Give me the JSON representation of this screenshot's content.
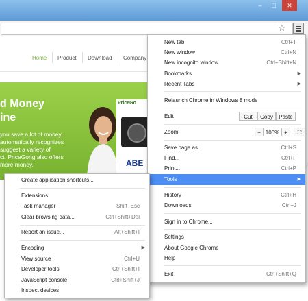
{
  "site": {
    "nav": [
      "Home",
      "Product",
      "Download",
      "Company"
    ],
    "hero_title_1": "d Money",
    "hero_title_2": "ine",
    "hero_lines": [
      "you save a lot of money.",
      "automatically recognizes",
      "suggest a variety of",
      "ct. PriceGong also offers",
      "more money."
    ],
    "pricegong_label": "PriceGo",
    "abe_label": "ABE"
  },
  "chrome_menu": {
    "items": [
      {
        "label": "New tab",
        "shortcut": "Ctrl+T"
      },
      {
        "label": "New window",
        "shortcut": "Ctrl+N"
      },
      {
        "label": "New incognito window",
        "shortcut": "Ctrl+Shift+N"
      },
      {
        "label": "Bookmarks",
        "shortcut": ""
      },
      {
        "label": "Recent Tabs",
        "shortcut": ""
      },
      {
        "label": "Relaunch Chrome in Windows 8 mode",
        "shortcut": ""
      },
      {
        "label": "Edit",
        "shortcut": ""
      },
      {
        "label": "Zoom",
        "shortcut": ""
      },
      {
        "label": "Save page as...",
        "shortcut": "Ctrl+S"
      },
      {
        "label": "Find...",
        "shortcut": "Ctrl+F"
      },
      {
        "label": "Print...",
        "shortcut": "Ctrl+P"
      },
      {
        "label": "Tools",
        "shortcut": ""
      },
      {
        "label": "History",
        "shortcut": "Ctrl+H"
      },
      {
        "label": "Downloads",
        "shortcut": "Ctrl+J"
      },
      {
        "label": "Sign in to Chrome...",
        "shortcut": ""
      },
      {
        "label": "Settings",
        "shortcut": ""
      },
      {
        "label": "About Google Chrome",
        "shortcut": ""
      },
      {
        "label": "Help",
        "shortcut": ""
      },
      {
        "label": "Exit",
        "shortcut": "Ctrl+Shift+Q"
      }
    ],
    "edit_buttons": [
      "Cut",
      "Copy",
      "Paste"
    ],
    "zoom": {
      "minus": "−",
      "value": "100%",
      "plus": "+"
    }
  },
  "tools_submenu": {
    "items": [
      {
        "label": "Create application shortcuts...",
        "shortcut": ""
      },
      {
        "label": "Extensions",
        "shortcut": ""
      },
      {
        "label": "Task manager",
        "shortcut": "Shift+Esc"
      },
      {
        "label": "Clear browsing data...",
        "shortcut": "Ctrl+Shift+Del"
      },
      {
        "label": "Report an issue...",
        "shortcut": "Alt+Shift+I"
      },
      {
        "label": "Encoding",
        "shortcut": ""
      },
      {
        "label": "View source",
        "shortcut": "Ctrl+U"
      },
      {
        "label": "Developer tools",
        "shortcut": "Ctrl+Shift+I"
      },
      {
        "label": "JavaScript console",
        "shortcut": "Ctrl+Shift+J"
      },
      {
        "label": "Inspect devices",
        "shortcut": ""
      }
    ]
  },
  "window_controls": {
    "minimize": "–",
    "maximize": "□",
    "close": "✕"
  },
  "icons": {
    "star": "star-icon",
    "menu": "hamburger-menu-icon"
  },
  "colors": {
    "highlight": "#4c8ef4",
    "hero_green": "#8ec63f",
    "nav_active": "#7cb342"
  }
}
